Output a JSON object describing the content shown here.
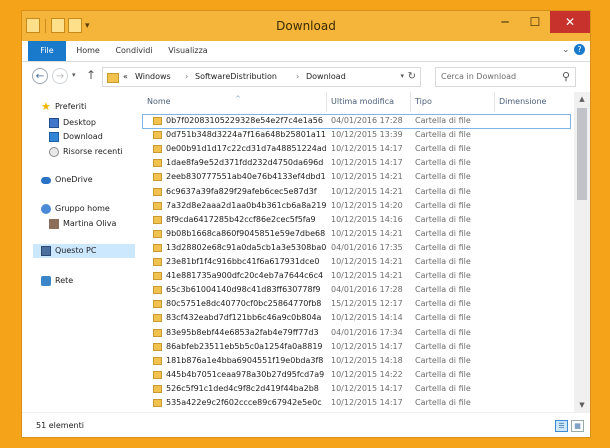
{
  "window": {
    "title": "Download"
  },
  "ribbon": {
    "tabs": [
      {
        "label": "File"
      },
      {
        "label": "Home"
      },
      {
        "label": "Condividi"
      },
      {
        "label": "Visualizza"
      }
    ]
  },
  "controls": {
    "minimize": "─",
    "maximize": "☐",
    "close": "✕",
    "help": "?"
  },
  "address": {
    "prefix": "«",
    "segments": [
      "Windows",
      "SoftwareDistribution",
      "Download"
    ],
    "separator": "›"
  },
  "search": {
    "placeholder": "Cerca in Download"
  },
  "nav_pane": {
    "favorites": "Preferiti",
    "desktop": "Desktop",
    "downloads": "Download",
    "recent": "Risorse recenti",
    "onedrive": "OneDrive",
    "homegroup": "Gruppo home",
    "user": "Martina Oliva",
    "pc": "Questo PC",
    "network": "Rete"
  },
  "columns": {
    "name": "Nome",
    "modified": "Ultima modifica",
    "type": "Tipo",
    "size": "Dimensione"
  },
  "rows": [
    {
      "name": "0b7f02083105229328e54e2f7c4e1a56",
      "modified": "04/01/2016 17:28",
      "type": "Cartella di file"
    },
    {
      "name": "0d751b348d3224a7f16a648b25801a11",
      "modified": "10/12/2015 13:39",
      "type": "Cartella di file"
    },
    {
      "name": "0e00b91d1d17c22cd31d7a48851224ad",
      "modified": "10/12/2015 14:17",
      "type": "Cartella di file"
    },
    {
      "name": "1dae8fa9e52d371fdd232d4750da696d",
      "modified": "10/12/2015 14:17",
      "type": "Cartella di file"
    },
    {
      "name": "2eeb830777551ab40e76b4133ef4dbd1",
      "modified": "10/12/2015 14:21",
      "type": "Cartella di file"
    },
    {
      "name": "6c9637a39fa829f29afeb6cec5e87d3f",
      "modified": "10/12/2015 14:21",
      "type": "Cartella di file"
    },
    {
      "name": "7a32d8e2aaa2d1aa0b4b361cb6a8a219",
      "modified": "10/12/2015 14:20",
      "type": "Cartella di file"
    },
    {
      "name": "8f9cda6417285b42ccf86e2cec5f5fa9",
      "modified": "10/12/2015 14:16",
      "type": "Cartella di file"
    },
    {
      "name": "9b08b1668ca860f9045851e59e7dbe68",
      "modified": "10/12/2015 14:21",
      "type": "Cartella di file"
    },
    {
      "name": "13d28802e68c91a0da5cb1a3e5308ba0",
      "modified": "04/01/2016 17:35",
      "type": "Cartella di file"
    },
    {
      "name": "23e81bf1f4c916bbc41f6a617931dce0",
      "modified": "10/12/2015 14:21",
      "type": "Cartella di file"
    },
    {
      "name": "41e881735a900dfc20c4eb7a7644c6c4",
      "modified": "10/12/2015 14:21",
      "type": "Cartella di file"
    },
    {
      "name": "65c3b61004140d98c41d83ff630778f9",
      "modified": "04/01/2016 17:28",
      "type": "Cartella di file"
    },
    {
      "name": "80c5751e8dc40770cf0bc25864770fb8",
      "modified": "15/12/2015 12:17",
      "type": "Cartella di file"
    },
    {
      "name": "83cf432eabd7df121bb6c46a9c0b804a",
      "modified": "10/12/2015 14:14",
      "type": "Cartella di file"
    },
    {
      "name": "83e95b8ebf44e6853a2fab4e79ff77d3",
      "modified": "04/01/2016 17:34",
      "type": "Cartella di file"
    },
    {
      "name": "86abfeb23511eb5b5c0a1254fa0a8819",
      "modified": "10/12/2015 14:17",
      "type": "Cartella di file"
    },
    {
      "name": "181b876a1e4bba6904551f19e0bda3f8",
      "modified": "10/12/2015 14:18",
      "type": "Cartella di file"
    },
    {
      "name": "445b4b7051ceaa978a30b27d95fcd7a9",
      "modified": "10/12/2015 14:22",
      "type": "Cartella di file"
    },
    {
      "name": "526c5f91c1ded4c9f8c2d419f44ba2b8",
      "modified": "10/12/2015 14:17",
      "type": "Cartella di file"
    },
    {
      "name": "535a422e9c2f602ccce89c67942e5e0c",
      "modified": "10/12/2015 14:17",
      "type": "Cartella di file"
    }
  ],
  "status": {
    "count": "51 elementi"
  },
  "colors": {
    "titlebar": "#f5b53a",
    "file_tab": "#1979ca",
    "selection": "#cce8ff",
    "desktop": "#f5a419"
  },
  "icons": [
    "folder-icon",
    "star-icon",
    "monitor-icon",
    "cloud-icon",
    "homegroup-icon",
    "pc-icon",
    "network-icon",
    "search-icon",
    "refresh-icon"
  ]
}
